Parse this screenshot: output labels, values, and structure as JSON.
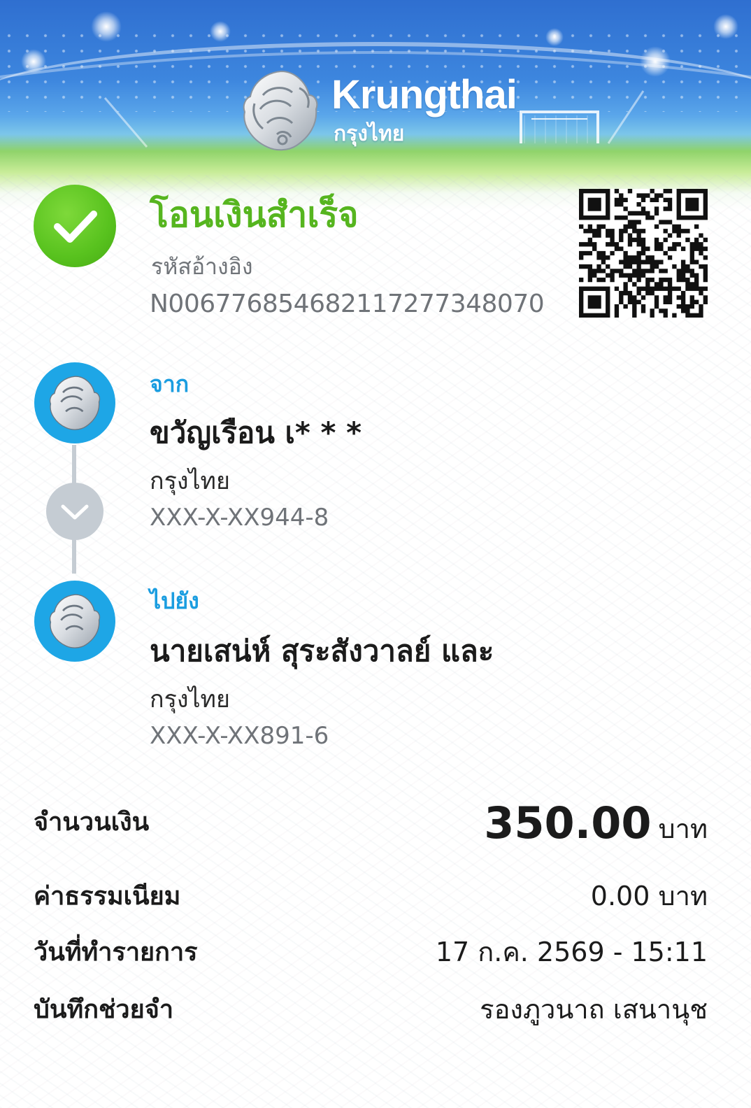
{
  "colors": {
    "success": "#56b51f",
    "brand_blue": "#1ea6e6",
    "label_blue": "#1a9de0",
    "muted": "#6f7378"
  },
  "header": {
    "brand_en": "Krungthai",
    "brand_th": "กรุงไทย"
  },
  "status": {
    "title": "โอนเงินสำเร็จ",
    "ref_label": "รหัสอ้างอิง",
    "ref_value": "N006776854682117277348070",
    "icon": "check-icon"
  },
  "from": {
    "label": "จาก",
    "name": "ขวัญเรือน เ* * *",
    "bank": "กรุงไทย",
    "account": "XXX-X-XX944-8"
  },
  "to": {
    "label": "ไปยัง",
    "name": "นายเสน่ห์ สุระสังวาลย์ และ",
    "bank": "กรุงไทย",
    "account": "XXX-X-XX891-6"
  },
  "summary": {
    "amount_label": "จำนวนเงิน",
    "amount_value": "350.00",
    "amount_unit": "บาท",
    "fee_label": "ค่าธรรมเนียม",
    "fee_value": "0.00 บาท",
    "date_label": "วันที่ทำรายการ",
    "date_value": "17 ก.ค. 2569 - 15:11",
    "memo_label": "บันทึกช่วยจำ",
    "memo_value": "รองภูวนาถ เสนานุช"
  }
}
